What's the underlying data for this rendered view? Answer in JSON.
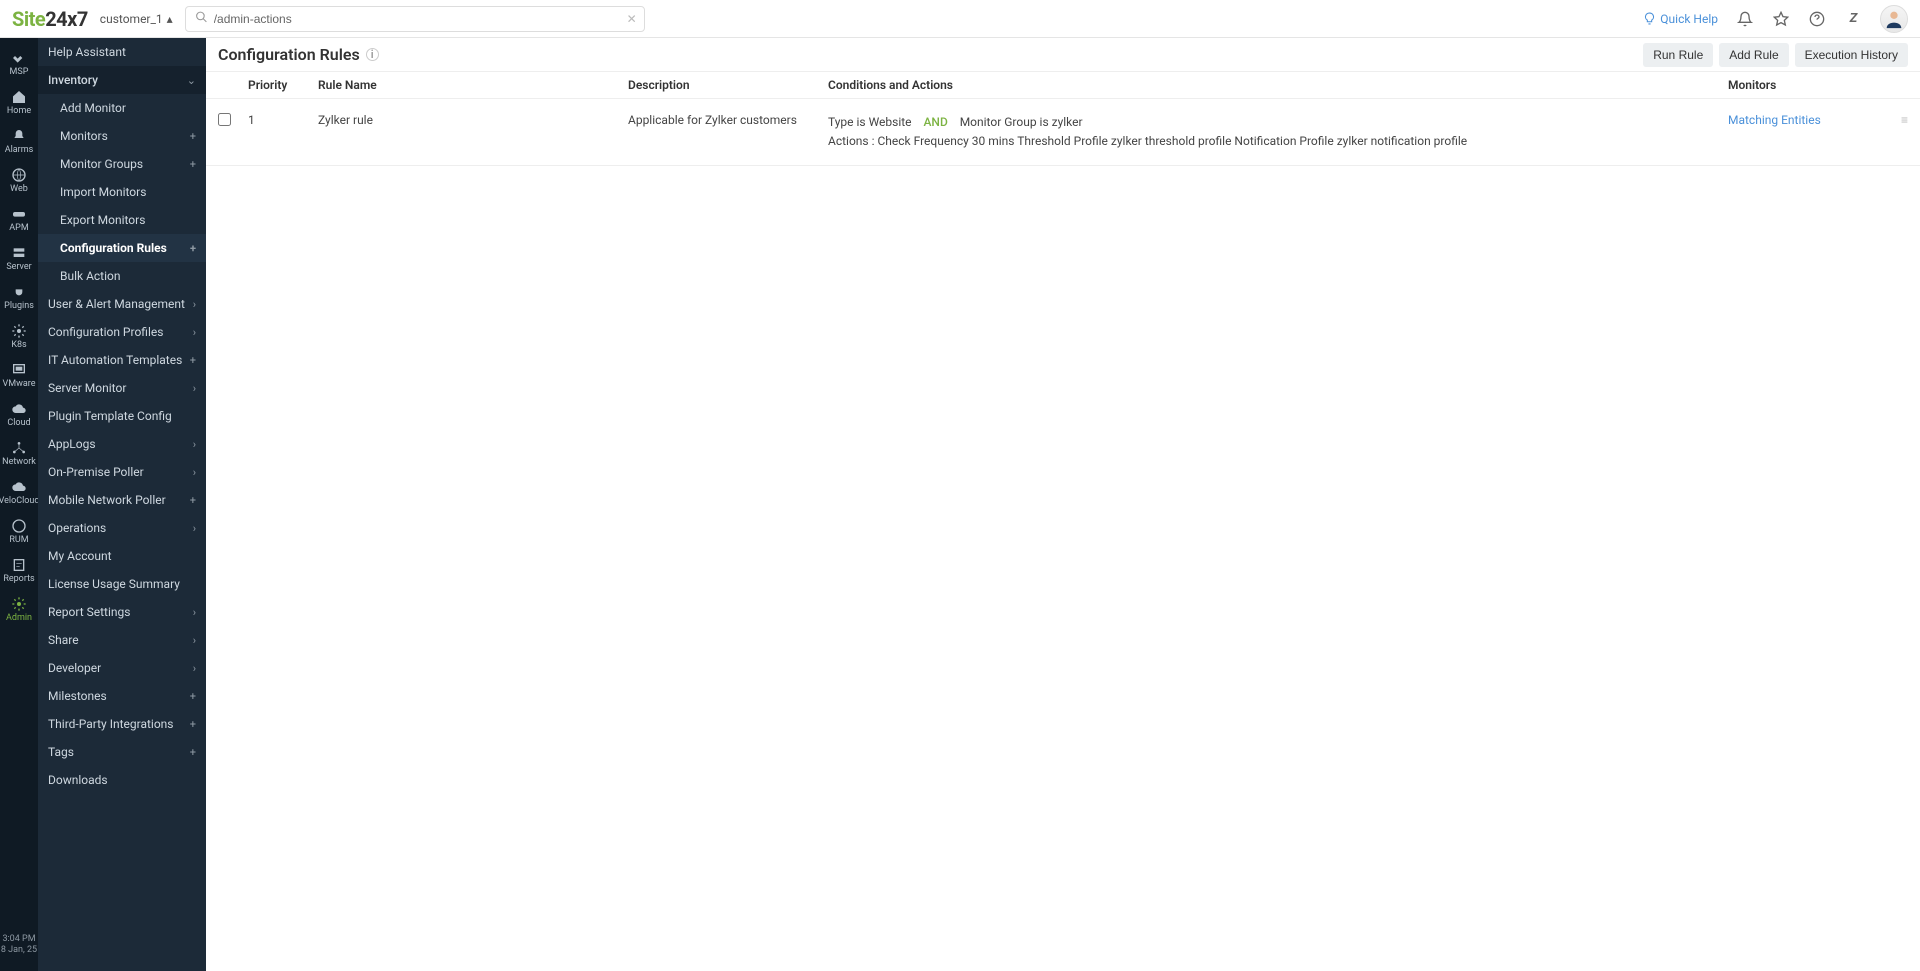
{
  "topbar": {
    "logo_site": "Site",
    "logo_rest": "24x7",
    "customer": "customer_1",
    "search_value": "/admin-actions",
    "quick_help": "Quick Help"
  },
  "rail": {
    "items": [
      {
        "id": "msp",
        "label": "MSP",
        "icon": "handshake"
      },
      {
        "id": "home",
        "label": "Home",
        "icon": "home"
      },
      {
        "id": "alarms",
        "label": "Alarms",
        "icon": "bell"
      },
      {
        "id": "web",
        "label": "Web",
        "icon": "globe"
      },
      {
        "id": "apm",
        "label": "APM",
        "icon": "goggles"
      },
      {
        "id": "server",
        "label": "Server",
        "icon": "server"
      },
      {
        "id": "plugins",
        "label": "Plugins",
        "icon": "plug"
      },
      {
        "id": "k8s",
        "label": "K8s",
        "icon": "gear"
      },
      {
        "id": "vmware",
        "label": "VMware",
        "icon": "vm"
      },
      {
        "id": "cloud",
        "label": "Cloud",
        "icon": "cloud"
      },
      {
        "id": "network",
        "label": "Network",
        "icon": "net"
      },
      {
        "id": "velocloud",
        "label": "VeloCloud",
        "icon": "cloud2"
      },
      {
        "id": "rum",
        "label": "RUM",
        "icon": "globe2"
      },
      {
        "id": "reports",
        "label": "Reports",
        "icon": "report"
      },
      {
        "id": "admin",
        "label": "Admin",
        "icon": "gear2",
        "active": true
      }
    ],
    "time": "3:04 PM",
    "date": "8 Jan, 25"
  },
  "sidebar": {
    "items": [
      {
        "label": "Help Assistant",
        "indent": 1
      },
      {
        "label": "Inventory",
        "indent": 1,
        "expand": "down",
        "section": true
      },
      {
        "label": "Add Monitor",
        "indent": 2
      },
      {
        "label": "Monitors",
        "indent": 2,
        "plus": true
      },
      {
        "label": "Monitor Groups",
        "indent": 2,
        "plus": true
      },
      {
        "label": "Import Monitors",
        "indent": 2
      },
      {
        "label": "Export Monitors",
        "indent": 2
      },
      {
        "label": "Configuration Rules",
        "indent": 2,
        "plus": true,
        "active": true
      },
      {
        "label": "Bulk Action",
        "indent": 2
      },
      {
        "label": "User & Alert Management",
        "indent": 1,
        "expand": "right"
      },
      {
        "label": "Configuration Profiles",
        "indent": 1,
        "expand": "right"
      },
      {
        "label": "IT Automation Templates",
        "indent": 1,
        "plus": true
      },
      {
        "label": "Server Monitor",
        "indent": 1,
        "expand": "right"
      },
      {
        "label": "Plugin Template Config",
        "indent": 1
      },
      {
        "label": "AppLogs",
        "indent": 1,
        "expand": "right"
      },
      {
        "label": "On-Premise Poller",
        "indent": 1,
        "expand": "right"
      },
      {
        "label": "Mobile Network Poller",
        "indent": 1,
        "plus": true
      },
      {
        "label": "Operations",
        "indent": 1,
        "expand": "right"
      },
      {
        "label": "My Account",
        "indent": 1
      },
      {
        "label": "License Usage Summary",
        "indent": 1
      },
      {
        "label": "Report Settings",
        "indent": 1,
        "expand": "right"
      },
      {
        "label": "Share",
        "indent": 1,
        "expand": "right"
      },
      {
        "label": "Developer",
        "indent": 1,
        "expand": "right"
      },
      {
        "label": "Milestones",
        "indent": 1,
        "plus": true
      },
      {
        "label": "Third-Party Integrations",
        "indent": 1,
        "plus": true
      },
      {
        "label": "Tags",
        "indent": 1,
        "plus": true
      },
      {
        "label": "Downloads",
        "indent": 1
      }
    ]
  },
  "page": {
    "title": "Configuration Rules",
    "buttons": {
      "run": "Run Rule",
      "add": "Add Rule",
      "history": "Execution History"
    }
  },
  "table": {
    "headers": {
      "priority": "Priority",
      "rule": "Rule Name",
      "desc": "Description",
      "cond": "Conditions and Actions",
      "mon": "Monitors"
    },
    "row": {
      "priority": "1",
      "name": "Zylker rule",
      "desc": "Applicable for Zylker customers",
      "cond_line1_a": "Type   is   Website",
      "cond_line1_and": "AND",
      "cond_line1_b": "Monitor Group   is   zylker",
      "cond_line2": "Actions   :  Check Frequency 30 mins      Threshold Profile zylker threshold profile      Notification Profile zylker notification profile",
      "monitors": "Matching Entities"
    }
  }
}
